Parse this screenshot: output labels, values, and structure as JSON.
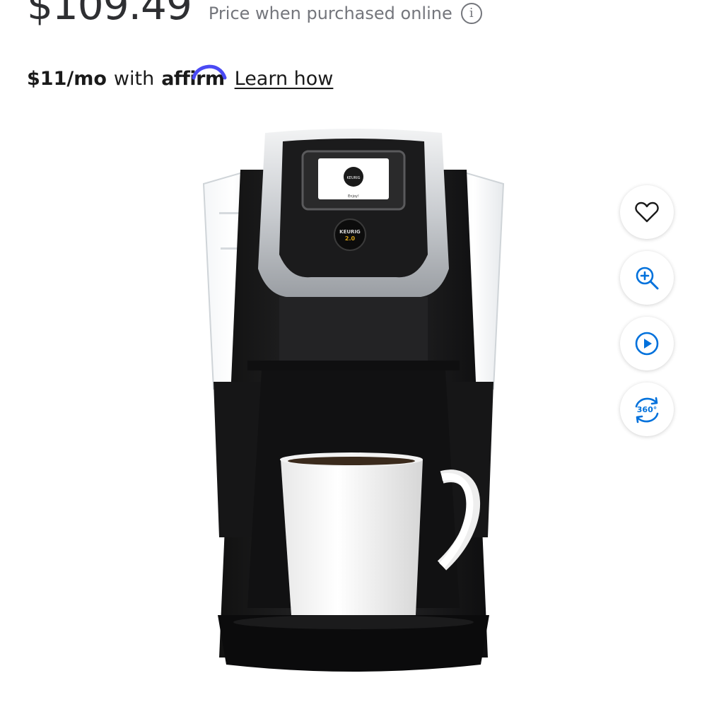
{
  "pricing": {
    "price": "$109.49",
    "price_note": "Price when purchased online",
    "info_icon": "info-icon"
  },
  "financing": {
    "monthly": "$11/mo",
    "with_text": "with",
    "provider": "affirm",
    "learn_link": "Learn how",
    "provider_color": "#4a4af4"
  },
  "product_image": {
    "brand_badge": "KEURIG",
    "model_badge": "KEURIG",
    "model_number": "2.0",
    "screen_text": "Enjoy!"
  },
  "side_actions": [
    {
      "icon": "heart-icon"
    },
    {
      "icon": "zoom-in-icon"
    },
    {
      "icon": "play-icon"
    },
    {
      "icon": "rotate-360-icon",
      "label": "360°"
    }
  ],
  "colors": {
    "accent_blue": "#0071dc",
    "text_dark": "#2e2f32",
    "text_muted": "#74767c"
  }
}
